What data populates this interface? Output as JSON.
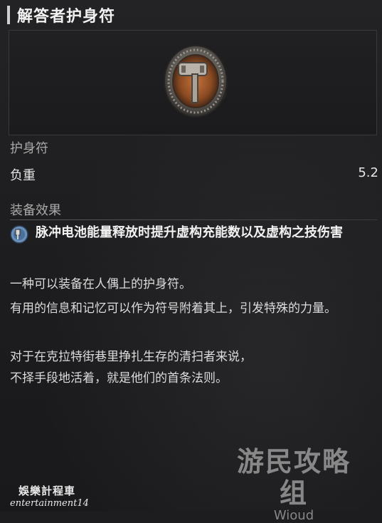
{
  "item": {
    "title": "解答者护身符",
    "category": "护身符",
    "weight_label": "负重",
    "weight_value": "5.2",
    "effect_section": "装备效果",
    "effect_text": "脉冲电池能量释放时提升虚构充能数以及虚构之技伤害",
    "description": [
      "一种可以装备在人偶上的护身符。",
      "有用的信息和记忆可以作为符号附着其上，引发特殊的力量。",
      "对于在克拉特街巷里挣扎生存的清扫者来说，",
      "不择手段地活着，就是他们的首条法则。"
    ]
  },
  "watermarks": {
    "right_main": "游民攻略组",
    "right_sub": "Wioud",
    "left_line1": "娛樂計程車",
    "left_line2": "entertainment14"
  },
  "icons": {
    "amulet": "amulet-image",
    "effect": "pulse-battery-icon"
  }
}
